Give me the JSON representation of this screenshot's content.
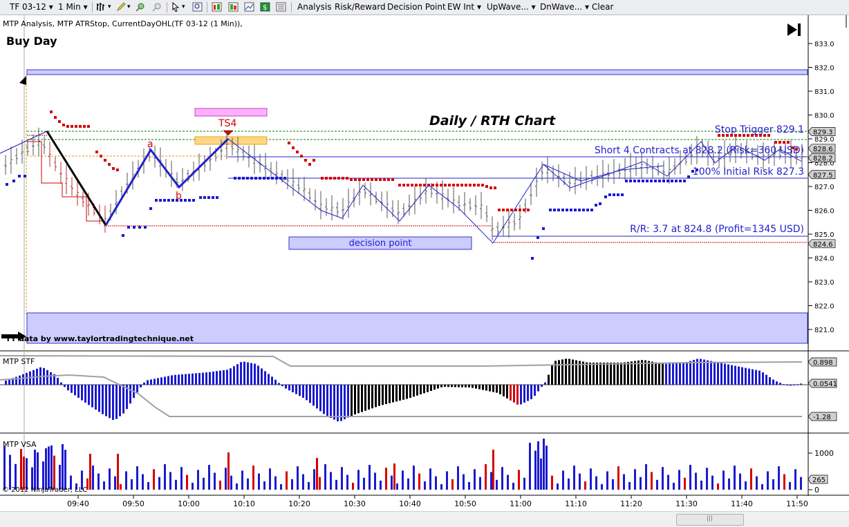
{
  "toolbar": {
    "instrument": "TF 03-12",
    "interval": "1 Min",
    "menus": [
      "Analysis",
      "Risk/Reward",
      "Decision Point",
      "EW Int",
      "UpWave...",
      "DnWave...",
      "Clear"
    ]
  },
  "chart": {
    "indicator_line": "MTP Analysis, MTP ATRStop, CurrentDayOHL(TF 03-12 (1 Min)),",
    "buy_day": "Buy Day",
    "title": "Daily / RTH Chart",
    "ts_label": "TS4",
    "wave_a": "a",
    "wave_b": "b",
    "decision_point": "decision point",
    "stop_trigger": "Stop Trigger 829.1",
    "short_entry": "Short 4 Contracts at 828.2 (Risk=360 USD)",
    "initial_risk": "100% Initial Risk 827.3",
    "rr": "R/R: 3.7 at 824.8 (Profit=1345 USD)",
    "credit": "TT data by www.taylortradingtechnique.net",
    "copyright": "© 2012 NinjaTrader, LLC",
    "price_ticks": [
      "833.0",
      "832.0",
      "831.0",
      "830.0",
      "829.0",
      "828.0",
      "827.0",
      "826.0",
      "825.0",
      "824.0",
      "823.0",
      "822.0",
      "821.0"
    ],
    "price_markers": [
      "829.3",
      "828.6",
      "828.2",
      "827.5",
      "824.6"
    ],
    "time_ticks": [
      "09:40",
      "09:50",
      "10:00",
      "10:10",
      "10:20",
      "10:30",
      "10:40",
      "10:50",
      "11:00",
      "11:10",
      "11:20",
      "11:30",
      "11:40",
      "11:50"
    ],
    "colors": {
      "wave_blue": "#2222cc",
      "impulse_black": "#000000",
      "stop_red": "#d40000",
      "bar_blue": "#1a1ad0",
      "band_fill": "#ccccff"
    }
  },
  "stf_panel": {
    "label": "MTP STF",
    "markers": [
      "0.898",
      "0.0541",
      "-1.28"
    ]
  },
  "vsa_panel": {
    "label": "MTP VSA",
    "ticks": [
      "1000",
      "0"
    ],
    "marker": "265"
  }
}
